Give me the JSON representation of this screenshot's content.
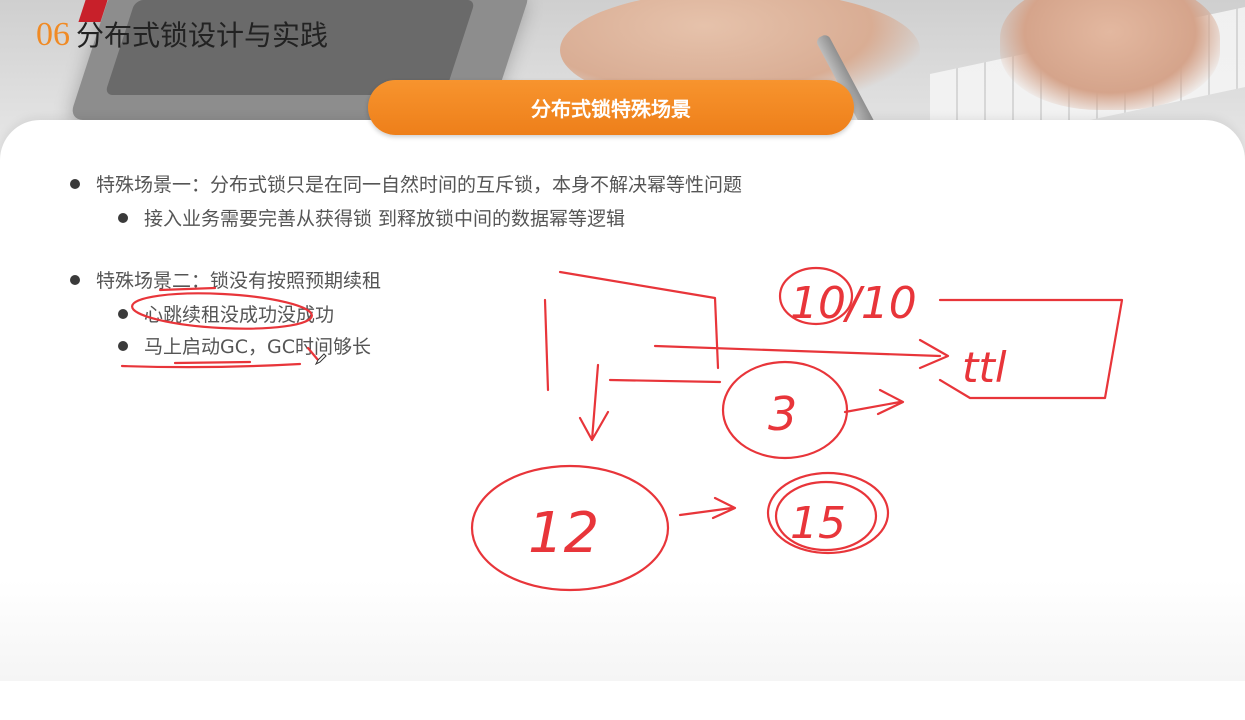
{
  "header": {
    "section_number": "06",
    "section_title": "分布式锁设计与实践"
  },
  "banner": {
    "title": "分布式锁特殊场景"
  },
  "bullets": [
    {
      "text": "特殊场景一：分布式锁只是在同一自然时间的互斥锁，本身不解决幂等性问题",
      "children": [
        {
          "text": "接入业务需要完善从获得锁 到释放锁中间的数据幂等逻辑"
        }
      ]
    },
    {
      "text": "特殊场景二：锁没有按照预期续租",
      "children": [
        {
          "text": "心跳续租没成功没成功"
        },
        {
          "text": "马上启动GC，GC时间够长"
        }
      ]
    }
  ],
  "annotations": {
    "color": "#e8353a",
    "handwriting": [
      "10/10",
      "ttl",
      "3",
      "12",
      "15"
    ]
  },
  "colors": {
    "accent": "#f08a24",
    "banner": "#f7942e",
    "ink": "#e8353a"
  }
}
